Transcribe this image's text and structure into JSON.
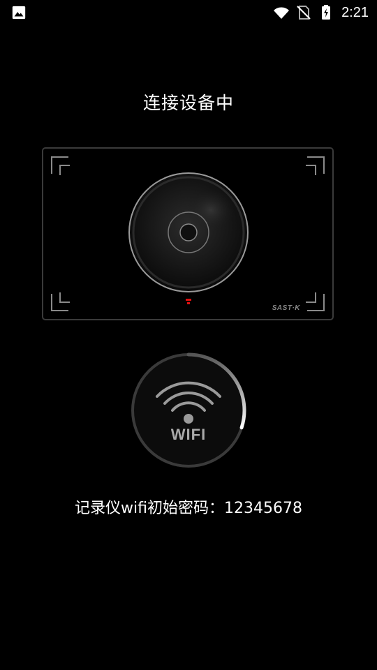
{
  "status_bar": {
    "time": "2:21",
    "left_icon": "image-icon",
    "icons": [
      "wifi-icon",
      "no-sim-icon",
      "battery-charging-icon"
    ]
  },
  "title": "连接设备中",
  "camera": {
    "brand": "SAST·K",
    "icon": "dashcam-lens-icon",
    "indicator_color": "#e01010"
  },
  "wifi": {
    "label": "WIFI",
    "progress_percent": 30
  },
  "password": {
    "label": "记录仪wifi初始密码：",
    "value": "12345678"
  },
  "colors": {
    "background": "#000000",
    "text": "#ffffff",
    "frame": "#3a3a3a"
  }
}
